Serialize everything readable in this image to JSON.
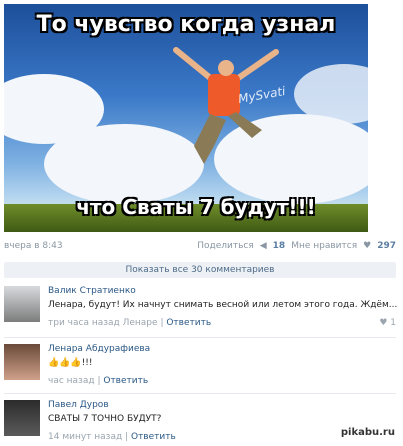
{
  "meme": {
    "top_text": "То чувство когда узнал",
    "bottom_text": "что Сваты 7 будут!!!",
    "watermark": "MySvati"
  },
  "post_meta": {
    "time": "вчера в 8:43",
    "share_label": "Поделиться",
    "share_count": "18",
    "like_label": "Мне нравится",
    "like_count": "297"
  },
  "show_all_comments": "Показать все 30 комментариев",
  "comments": [
    {
      "author": "Валик Стратиенко",
      "text": "Ленара, будут! Их начнут снимать весной или летом этого года. Ждём...",
      "meta": "три часа назад Ленаре",
      "reply": "Ответить",
      "likes": "1"
    },
    {
      "author": "Ленара Абдурафиева",
      "text": "👍👍👍!!!",
      "meta": "час назад",
      "reply": "Ответить"
    },
    {
      "author": "Павел Дуров",
      "text": "СВАТЫ 7 ТОЧНО БУДУТ?",
      "meta": "14 минут назад",
      "reply": "Ответить"
    }
  ],
  "footer_watermark": "pikabu.ru"
}
